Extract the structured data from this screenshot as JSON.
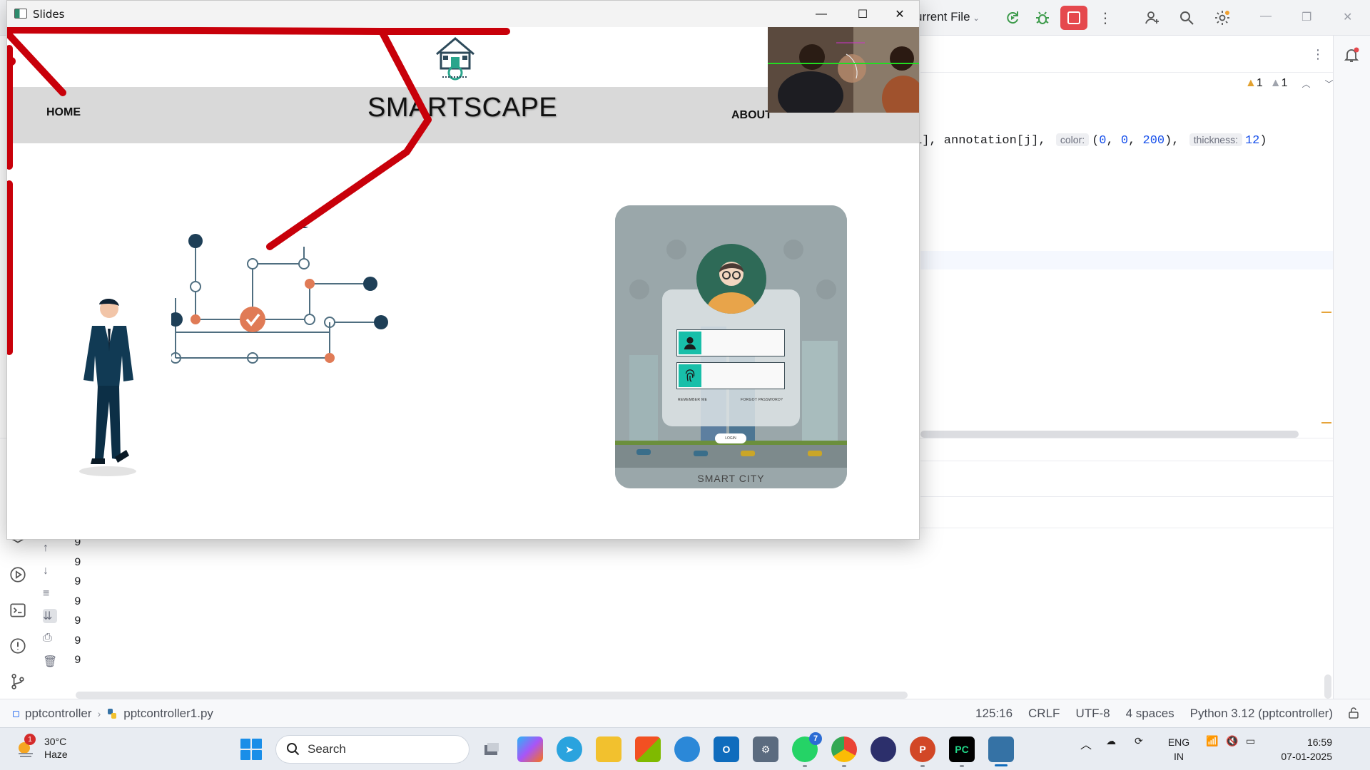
{
  "ide": {
    "run_config": "urrent File",
    "code_line": {
      "prefix": "1], annotation[j],",
      "hint_color": "color:",
      "color_value_open": "(",
      "c0": "0",
      "c1": "0",
      "c2": "200",
      "color_value_close": "),",
      "hint_thickness": "thickness:",
      "thickness": "12",
      "close": ")"
    },
    "warnings": {
      "count_a": "1",
      "count_b": "1"
    },
    "console_lines": [
      "9",
      "9",
      "9",
      "9",
      "9",
      "9",
      "9"
    ],
    "status": {
      "project": "pptcontroller",
      "file": "pptcontroller1.py",
      "position": "125:16",
      "line_sep": "CRLF",
      "encoding": "UTF-8",
      "indent": "4 spaces",
      "interpreter": "Python 3.12 (pptcontroller)"
    },
    "colors": {
      "stop": "#e5484d",
      "accent": "#3574f0",
      "warning": "#e2a12f"
    }
  },
  "slides_window": {
    "title": "Slides",
    "slide": {
      "nav_home": "HOME",
      "brand": "SMARTSCAPE",
      "nav_about": "ABOUT",
      "phone_caption": "SMART CITY",
      "remember_me": "REMEMBER ME",
      "forgot_password": "FORGOT PASSWORD?",
      "login": "LOGIN",
      "annotation_color": "#c8000a"
    }
  },
  "taskbar": {
    "weather": {
      "temp": "30°C",
      "condition": "Haze",
      "badge": "1"
    },
    "search_placeholder": "Search",
    "whatsapp_badge": "7",
    "lang_top": "ENG",
    "lang_bottom": "IN",
    "time": "16:59",
    "date": "07-01-2025"
  }
}
